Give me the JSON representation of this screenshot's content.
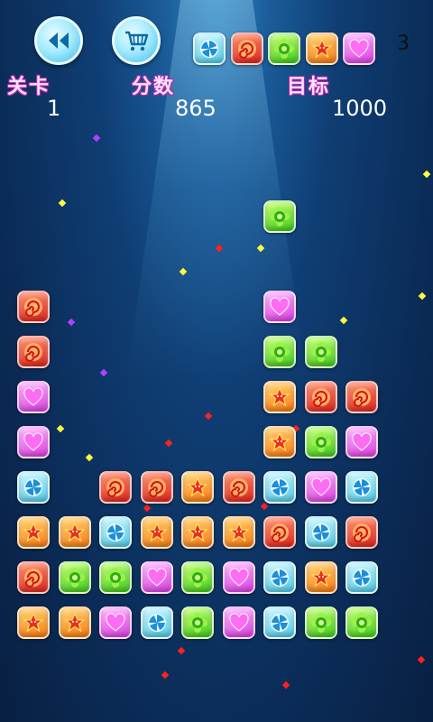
{
  "hud": {
    "level_label": "关卡",
    "level_value": "1",
    "score_label": "分数",
    "score_value": "865",
    "target_label": "目标",
    "target_value": "1000",
    "target_count": "3"
  },
  "icons": {
    "back": "rewind-icon",
    "shop": "shopping-cart-icon"
  },
  "tile_colors": {
    "blue": "#52d0ef",
    "red": "#e8231c",
    "green": "#3fcf1c",
    "orange": "#ff7b13",
    "pink": "#e23de6"
  },
  "target_tiles": [
    "blue",
    "red",
    "green",
    "orange",
    "pink"
  ],
  "board": [
    [
      null,
      null,
      null,
      null,
      null,
      null,
      null,
      null,
      null,
      null
    ],
    [
      null,
      null,
      null,
      null,
      null,
      null,
      null,
      null,
      null,
      null
    ],
    [
      null,
      null,
      null,
      null,
      null,
      null,
      "green",
      null,
      null,
      null
    ],
    [
      null,
      null,
      null,
      null,
      null,
      null,
      null,
      null,
      null,
      null
    ],
    [
      "red",
      null,
      null,
      null,
      null,
      null,
      "pink",
      null,
      null,
      null
    ],
    [
      "red",
      null,
      null,
      null,
      null,
      null,
      "green",
      "green",
      null,
      null
    ],
    [
      "pink",
      null,
      null,
      null,
      null,
      null,
      "orange",
      "red",
      "red",
      null
    ],
    [
      "pink",
      null,
      null,
      null,
      null,
      null,
      "orange",
      "green",
      "pink",
      null
    ],
    [
      "blue",
      null,
      "red",
      "red",
      "orange",
      "red",
      "blue",
      "pink",
      "blue",
      null
    ],
    [
      "orange",
      "orange",
      "blue",
      "orange",
      "orange",
      "orange",
      "red",
      "blue",
      "red",
      null
    ],
    [
      "red",
      "green",
      "green",
      "pink",
      "green",
      "pink",
      "blue",
      "orange",
      "blue",
      null
    ],
    [
      "orange",
      "orange",
      "pink",
      "blue",
      "green",
      "pink",
      "blue",
      "green",
      "green",
      null
    ]
  ]
}
